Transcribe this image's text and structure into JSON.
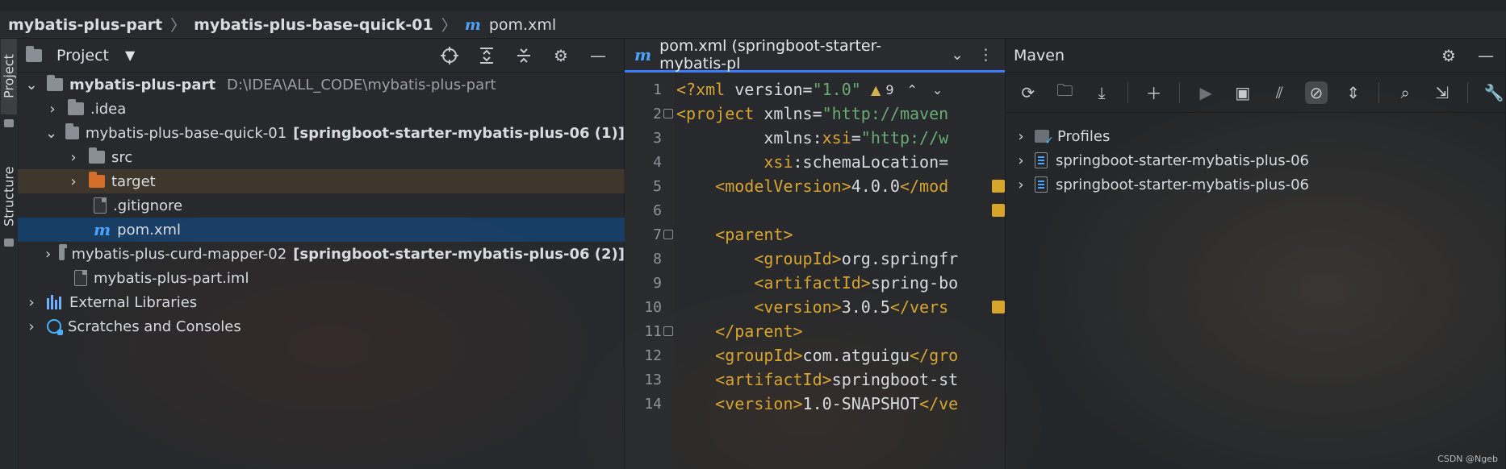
{
  "breadcrumb": {
    "items": [
      "mybatis-plus-part",
      "mybatis-plus-base-quick-01",
      "pom.xml"
    ]
  },
  "left_tabs": {
    "project": "Project",
    "structure": "Structure"
  },
  "project_panel": {
    "title": "Project",
    "tree": [
      {
        "label": "mybatis-plus-part",
        "path": "D:\\IDEA\\ALL_CODE\\mybatis-plus-part",
        "type": "module-root",
        "expanded": true
      },
      {
        "label": ".idea",
        "type": "folder",
        "expanded": false
      },
      {
        "label": "mybatis-plus-base-quick-01",
        "suffix": "[springboot-starter-mybatis-plus-06 (1)]",
        "type": "module",
        "expanded": true
      },
      {
        "label": "src",
        "type": "folder",
        "expanded": false
      },
      {
        "label": "target",
        "type": "folder-orange",
        "expanded": false
      },
      {
        "label": ".gitignore",
        "type": "file"
      },
      {
        "label": "pom.xml",
        "type": "maven-file",
        "selected": true
      },
      {
        "label": "mybatis-plus-curd-mapper-02",
        "suffix": "[springboot-starter-mybatis-plus-06 (2)]",
        "type": "module",
        "expanded": false
      },
      {
        "label": "mybatis-plus-part.iml",
        "type": "file"
      },
      {
        "label": "External Libraries",
        "type": "libraries",
        "expanded": false
      },
      {
        "label": "Scratches and Consoles",
        "type": "scratches",
        "expanded": false
      }
    ]
  },
  "editor": {
    "tab_title": "pom.xml (springboot-starter-mybatis-pl",
    "warning_count": "9",
    "lines": [
      {
        "n": "1",
        "parts": [
          {
            "t": "<?xml ",
            "c": "tag"
          },
          {
            "t": "version=",
            "c": "attr"
          },
          {
            "t": "\"1.0\"",
            "c": "val"
          }
        ]
      },
      {
        "n": "2",
        "parts": [
          {
            "t": "<project ",
            "c": "tag"
          },
          {
            "t": "xmlns=",
            "c": "attr"
          },
          {
            "t": "\"http://maven",
            "c": "val"
          }
        ]
      },
      {
        "n": "3",
        "parts": [
          {
            "t": "         ",
            "c": "txt"
          },
          {
            "t": "xmlns:",
            "c": "attr"
          },
          {
            "t": "xsi",
            "c": "tag"
          },
          {
            "t": "=",
            "c": "attr"
          },
          {
            "t": "\"http://w",
            "c": "val"
          }
        ]
      },
      {
        "n": "4",
        "parts": [
          {
            "t": "         ",
            "c": "txt"
          },
          {
            "t": "xsi",
            "c": "tag"
          },
          {
            "t": ":schemaLocation=",
            "c": "attr"
          }
        ]
      },
      {
        "n": "5",
        "parts": [
          {
            "t": "    ",
            "c": "txt"
          },
          {
            "t": "<modelVersion>",
            "c": "tag"
          },
          {
            "t": "4.0.0",
            "c": "txt"
          },
          {
            "t": "</mod",
            "c": "tag"
          }
        ]
      },
      {
        "n": "6",
        "parts": []
      },
      {
        "n": "7",
        "parts": [
          {
            "t": "    ",
            "c": "txt"
          },
          {
            "t": "<parent>",
            "c": "tag"
          }
        ]
      },
      {
        "n": "8",
        "parts": [
          {
            "t": "        ",
            "c": "txt"
          },
          {
            "t": "<groupId>",
            "c": "tag"
          },
          {
            "t": "org.springfr",
            "c": "txt"
          }
        ]
      },
      {
        "n": "9",
        "parts": [
          {
            "t": "        ",
            "c": "txt"
          },
          {
            "t": "<artifactId>",
            "c": "tag"
          },
          {
            "t": "spring-bo",
            "c": "txt"
          }
        ]
      },
      {
        "n": "10",
        "parts": [
          {
            "t": "        ",
            "c": "txt"
          },
          {
            "t": "<version>",
            "c": "tag"
          },
          {
            "t": "3.0.5",
            "c": "txt"
          },
          {
            "t": "</vers",
            "c": "tag"
          }
        ]
      },
      {
        "n": "11",
        "parts": [
          {
            "t": "    ",
            "c": "txt"
          },
          {
            "t": "</parent>",
            "c": "tag"
          }
        ]
      },
      {
        "n": "12",
        "parts": [
          {
            "t": "    ",
            "c": "txt"
          },
          {
            "t": "<groupId>",
            "c": "tag"
          },
          {
            "t": "com.atguigu",
            "c": "txt"
          },
          {
            "t": "</gro",
            "c": "tag"
          }
        ]
      },
      {
        "n": "13",
        "parts": [
          {
            "t": "    ",
            "c": "txt"
          },
          {
            "t": "<artifactId>",
            "c": "tag"
          },
          {
            "t": "springboot-st",
            "c": "txt"
          }
        ]
      },
      {
        "n": "14",
        "parts": [
          {
            "t": "    ",
            "c": "txt"
          },
          {
            "t": "<version>",
            "c": "tag"
          },
          {
            "t": "1.0-SNAPSHOT",
            "c": "txt"
          },
          {
            "t": "</ve",
            "c": "tag"
          }
        ]
      }
    ]
  },
  "maven": {
    "title": "Maven",
    "tree": [
      {
        "label": "Profiles",
        "type": "profiles"
      },
      {
        "label": "springboot-starter-mybatis-plus-06",
        "type": "project"
      },
      {
        "label": "springboot-starter-mybatis-plus-06",
        "type": "project"
      }
    ]
  },
  "watermark": "CSDN @Ngeb",
  "colors": {
    "tag": "#d7a52f",
    "value": "#6aab73",
    "selection": "#184270",
    "accent": "#3f7cff"
  }
}
